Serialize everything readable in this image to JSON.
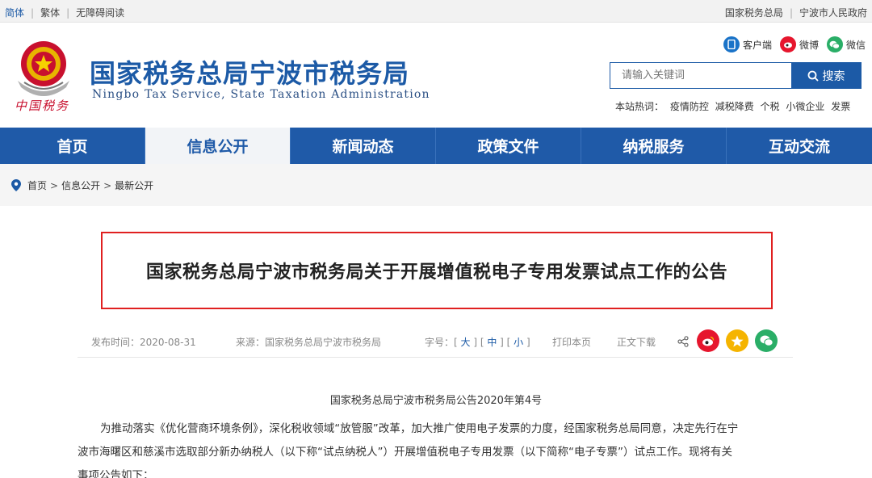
{
  "topbar": {
    "left": [
      "简体",
      "繁体",
      "无障碍阅读"
    ],
    "right": [
      "国家税务总局",
      "宁波市人民政府"
    ]
  },
  "header": {
    "emblem_text": "中国税务",
    "title": "国家税务总局宁波市税务局",
    "subtitle": "Ningbo Tax Service, State Taxation Administration",
    "social": [
      {
        "label": "客户端",
        "icon": "client-icon",
        "color": "#1a73c8"
      },
      {
        "label": "微博",
        "icon": "weibo-icon",
        "color": "#e6162d"
      },
      {
        "label": "微信",
        "icon": "wechat-icon",
        "color": "#2aae67"
      }
    ],
    "search": {
      "placeholder": "请输入关键词",
      "button": "搜索"
    },
    "hotwords_label": "本站热词：",
    "hotwords": [
      "疫情防控",
      "减税降费",
      "个税",
      "小微企业",
      "发票"
    ]
  },
  "nav": {
    "tabs": [
      "首页",
      "信息公开",
      "新闻动态",
      "政策文件",
      "纳税服务",
      "互动交流"
    ],
    "active_index": 1,
    "color": "#1f5aa8"
  },
  "breadcrumb": [
    "首页",
    "信息公开",
    "最新公开"
  ],
  "article": {
    "title": "国家税务总局宁波市税务局关于开展增值税电子专用发票试点工作的公告",
    "publish": "发布时间：2020-08-31",
    "source": "来源：国家税务总局宁波市税务局",
    "fontsize_label": "字号：",
    "sizes": [
      "大",
      "中",
      "小"
    ],
    "print": "打印本页",
    "download": "正文下载",
    "share_icons": [
      {
        "icon": "weibo-share-icon",
        "color": "#e6162d"
      },
      {
        "icon": "qzone-share-icon",
        "color": "#f5b400"
      },
      {
        "icon": "wechat-share-icon",
        "color": "#2aae67"
      }
    ],
    "doc_number": "国家税务总局宁波市税务局公告2020年第4号",
    "paragraph_lines": [
      "为推动落实《优化营商环境条例》，深化税收领域“放管服”改革，加大推广使用电子发票的力度，经国家税务总局同意，决定先行在宁",
      "波市海曙区和慈溪市选取部分新办纳税人（以下称“试点纳税人”）开展增值税电子专用发票（以下简称“电子专票”）试点工作。现将有关",
      "事项公告如下："
    ]
  }
}
